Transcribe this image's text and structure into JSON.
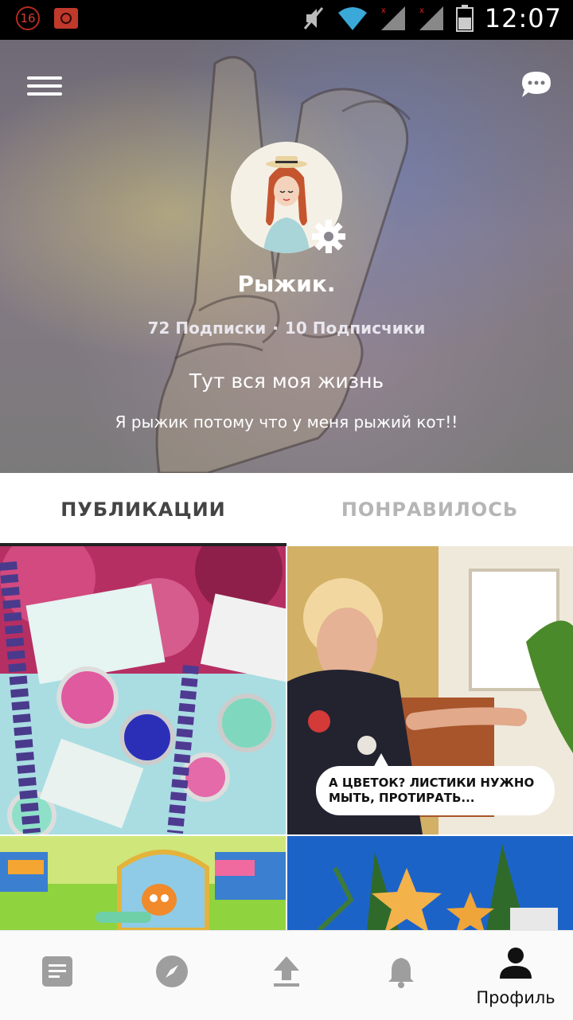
{
  "status_bar": {
    "notification_badge": "16",
    "time": "12:07"
  },
  "profile": {
    "name": "Рыжик.",
    "following_count": "72",
    "following_label": "Подписки",
    "followers_count": "10",
    "followers_label": "Подписчики",
    "separator": "·",
    "tagline": "Тут вся моя жизнь",
    "bio": "Я рыжик потому что у меня рыжий кот!!"
  },
  "tabs": [
    {
      "label": "ПУБЛИКАЦИИ",
      "active": true
    },
    {
      "label": "ПОНРАВИЛОСЬ",
      "active": false
    }
  ],
  "posts": [
    {
      "overlay_text": ""
    },
    {
      "overlay_text": "А ЦВЕТОК? ЛИСТИКИ НУЖНО МЫТЬ, ПРОТИРАТЬ..."
    },
    {
      "overlay_text": ""
    },
    {
      "overlay_text": ""
    }
  ],
  "bottom_nav": [
    {
      "icon": "feed-icon",
      "label": ""
    },
    {
      "icon": "compass-icon",
      "label": ""
    },
    {
      "icon": "upload-icon",
      "label": ""
    },
    {
      "icon": "bell-icon",
      "label": ""
    },
    {
      "icon": "profile-icon",
      "label": "Профиль",
      "active": true
    }
  ],
  "colors": {
    "active_tab": "#444444",
    "inactive_tab": "#b5b5b5",
    "nav_inactive": "#9e9e9e",
    "nav_active": "#111111"
  }
}
